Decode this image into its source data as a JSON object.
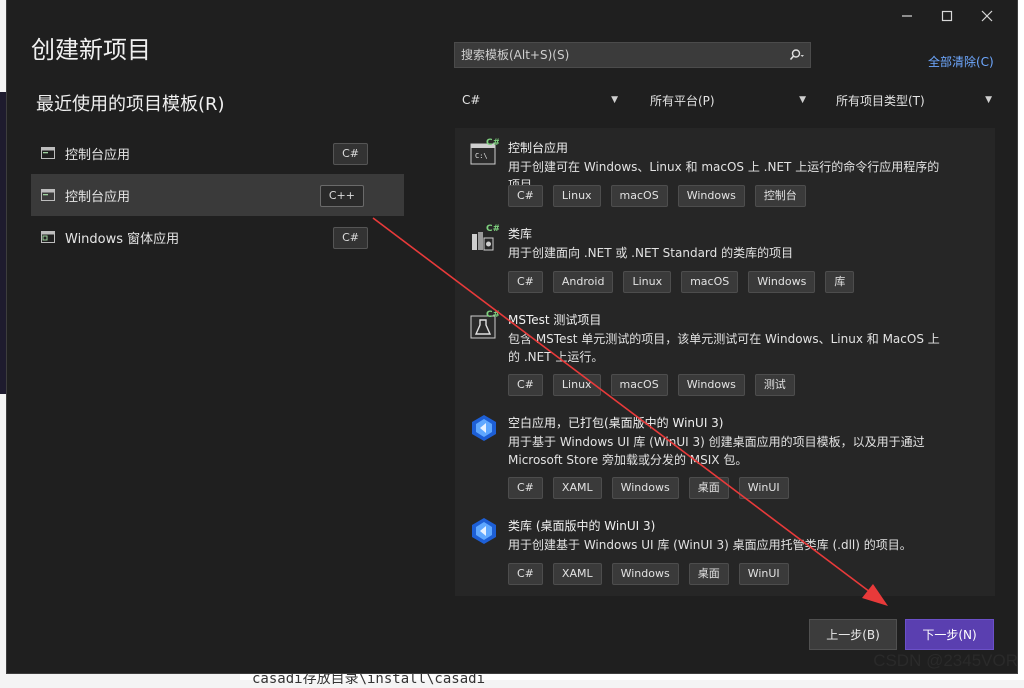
{
  "background": {
    "bottom_text": "casadi存放目录\\install\\casadi",
    "watermark": "CSDN @2345VOR"
  },
  "window": {
    "title": "创建新项目",
    "controls": [
      "minimize-icon",
      "maximize-icon",
      "close-icon"
    ]
  },
  "recent": {
    "heading": "最近使用的项目模板(R)",
    "items": [
      {
        "label": "控制台应用",
        "lang": "C#",
        "selected": false
      },
      {
        "label": "控制台应用",
        "lang": "C++",
        "selected": true
      },
      {
        "label": "Windows 窗体应用",
        "lang": "C#",
        "selected": false
      }
    ]
  },
  "search": {
    "placeholder": "搜索模板(Alt+S)(S)"
  },
  "clear_all": "全部清除(C)",
  "filters": {
    "language": "C#",
    "platform": "所有平台(P)",
    "project_type": "所有项目类型(T)"
  },
  "templates": [
    {
      "title": "控制台应用",
      "desc": "用于创建可在 Windows、Linux 和 macOS 上 .NET 上运行的命令行应用程序的项目",
      "tags": [
        "C#",
        "Linux",
        "macOS",
        "Windows",
        "控制台"
      ],
      "icon": "console-app-icon"
    },
    {
      "title": "类库",
      "desc": "用于创建面向 .NET 或 .NET Standard 的类库的项目",
      "tags": [
        "C#",
        "Android",
        "Linux",
        "macOS",
        "Windows",
        "库"
      ],
      "icon": "class-library-icon"
    },
    {
      "title": "MSTest 测试项目",
      "desc": "包含 MSTest 单元测试的项目，该单元测试可在 Windows、Linux 和 MacOS 上的 .NET 上运行。",
      "tags": [
        "C#",
        "Linux",
        "macOS",
        "Windows",
        "测试"
      ],
      "icon": "test-flask-icon"
    },
    {
      "title": "空白应用，已打包(桌面版中的 WinUI 3)",
      "desc": "用于基于 Windows UI 库 (WinUI 3) 创建桌面应用的项目模板，以及用于通过 Microsoft Store 旁加载或分发的 MSIX 包。",
      "tags": [
        "C#",
        "XAML",
        "Windows",
        "桌面",
        "WinUI"
      ],
      "icon": "winui-icon"
    },
    {
      "title": "类库 (桌面版中的 WinUI 3)",
      "desc": "用于创建基于 Windows UI 库 (WinUI 3) 桌面应用托管类库 (.dll) 的项目。",
      "tags": [
        "C#",
        "XAML",
        "Windows",
        "桌面",
        "WinUI"
      ],
      "icon": "winui-icon"
    }
  ],
  "buttons": {
    "back": "上一步(B)",
    "next": "下一步(N)"
  },
  "colors": {
    "dialog_bg": "#1f1f1f",
    "accent_next": "#5a3fb0",
    "link": "#6ea8ff",
    "annotation_arrow": "#e83a3a"
  }
}
